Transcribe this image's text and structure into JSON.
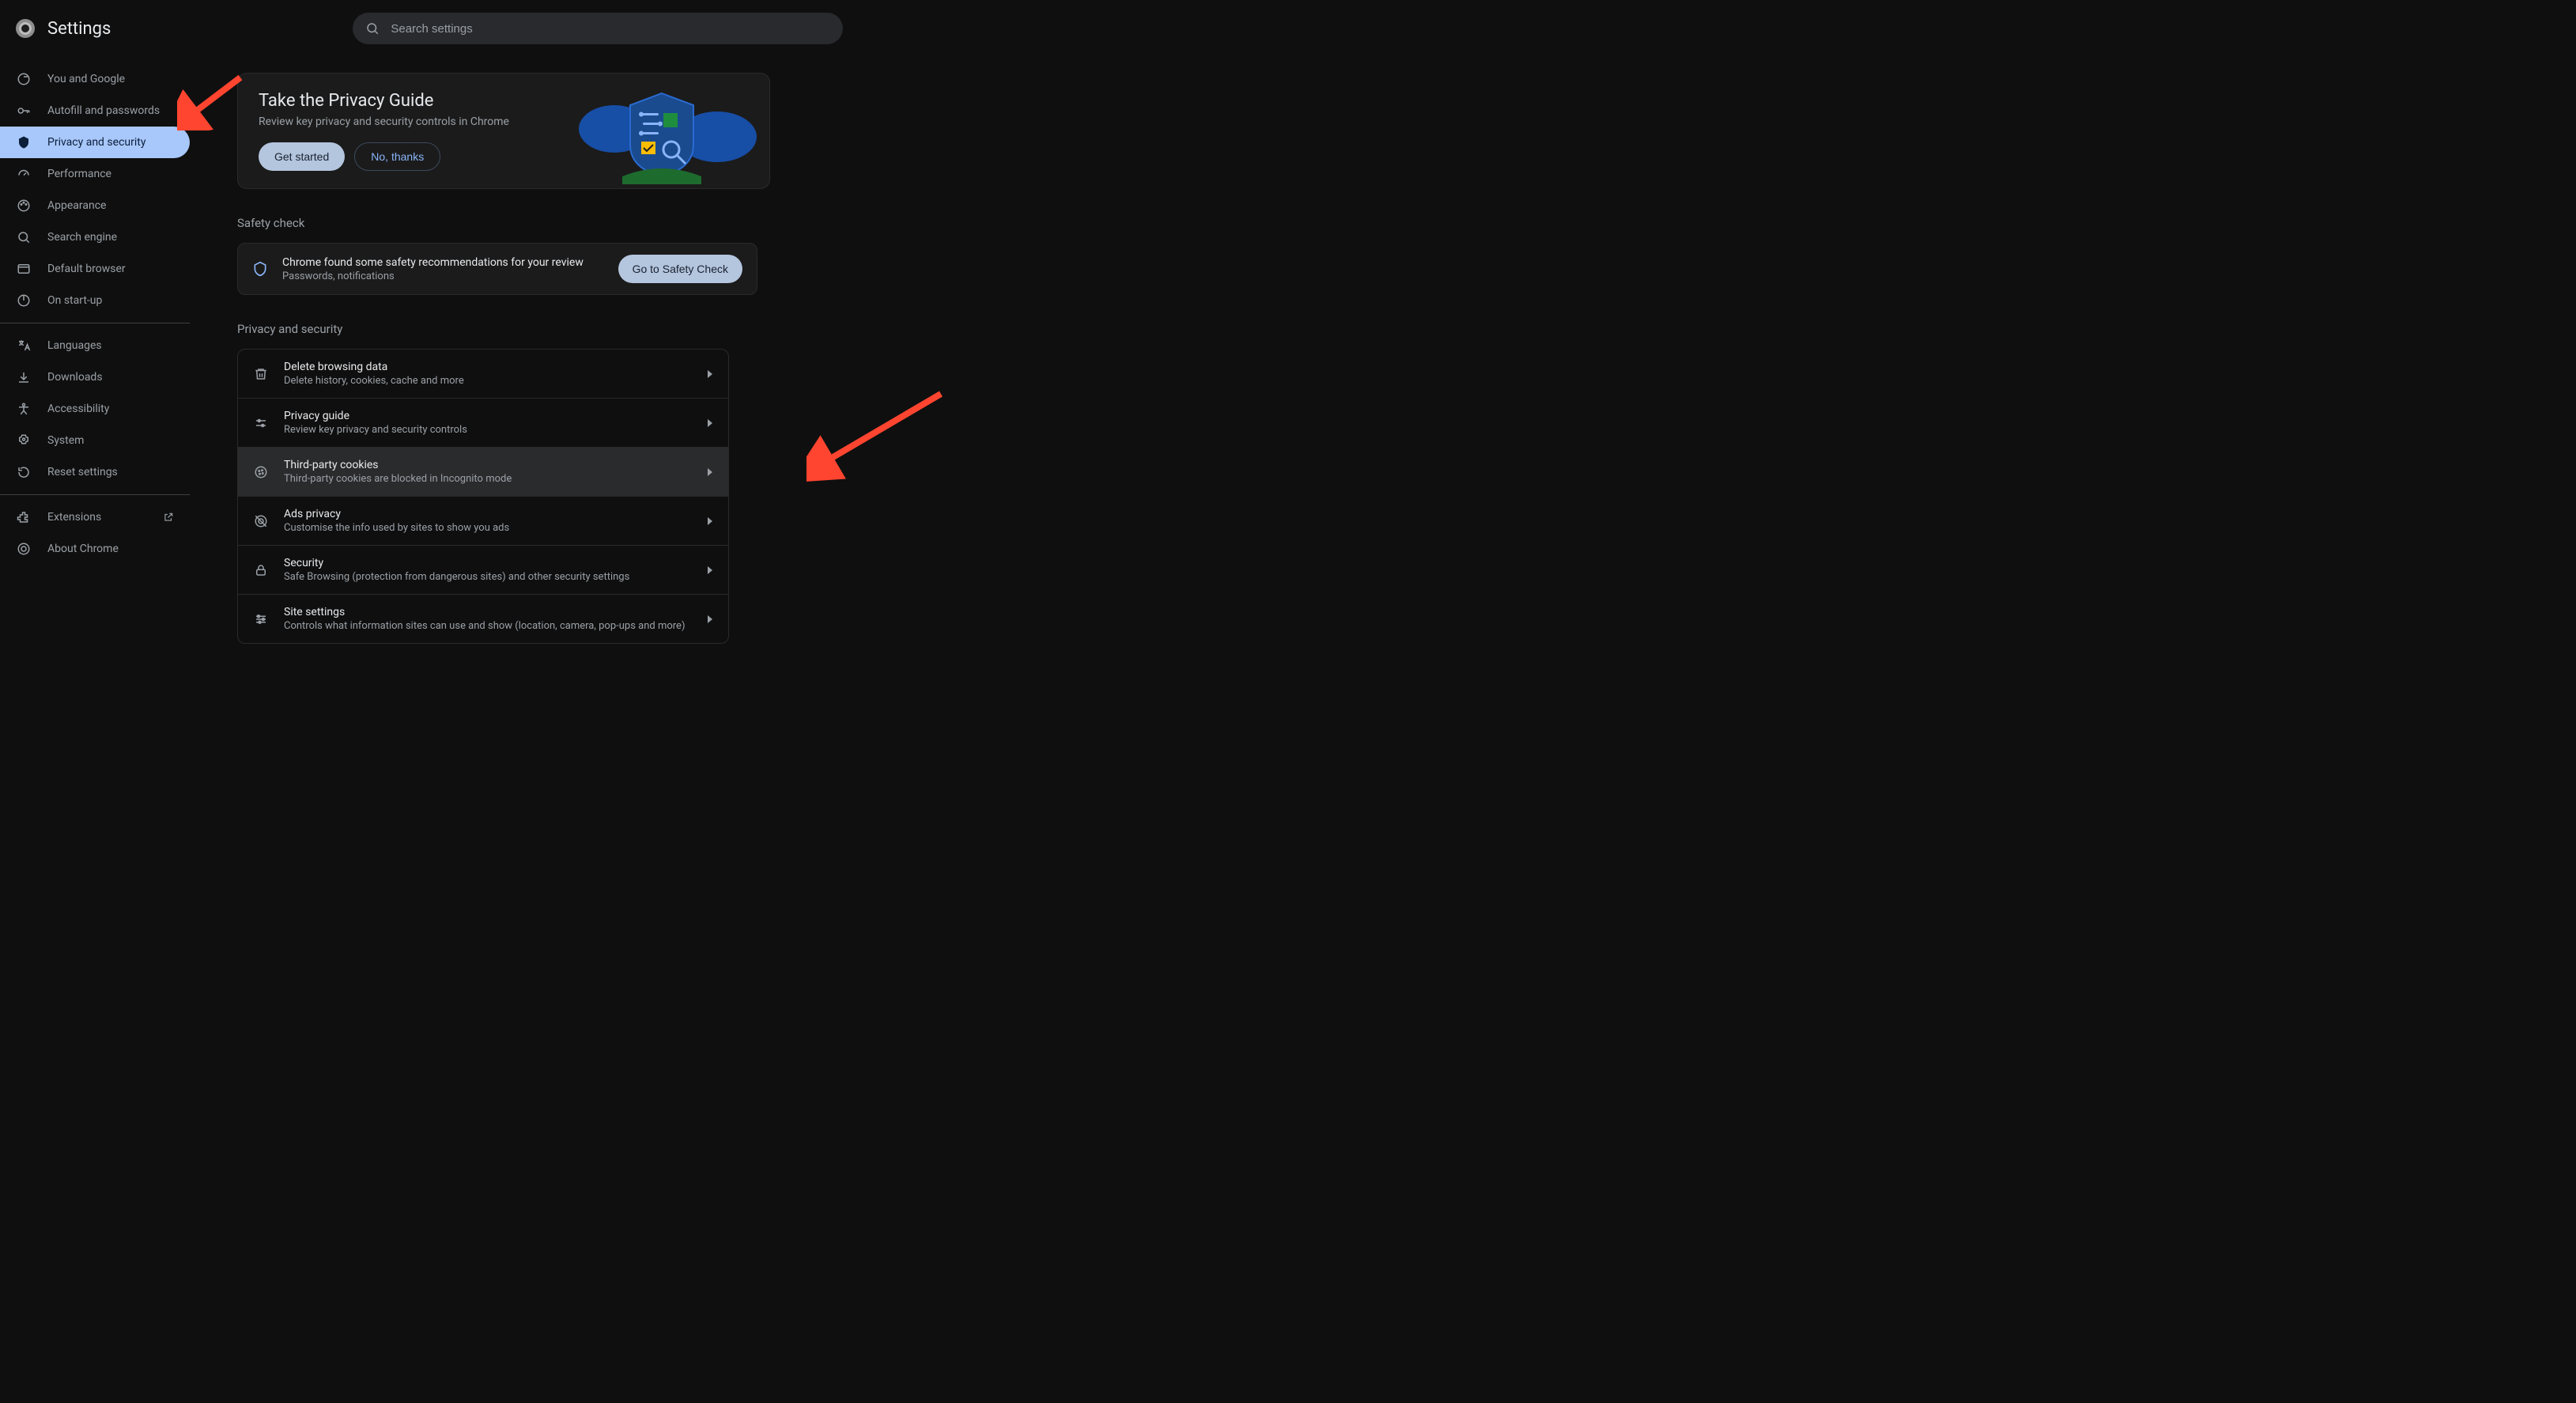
{
  "header": {
    "title": "Settings",
    "search_placeholder": "Search settings"
  },
  "sidebar": {
    "items": [
      {
        "label": "You and Google",
        "icon": "google"
      },
      {
        "label": "Autofill and passwords",
        "icon": "key"
      },
      {
        "label": "Privacy and security",
        "icon": "shield",
        "selected": true
      },
      {
        "label": "Performance",
        "icon": "speed"
      },
      {
        "label": "Appearance",
        "icon": "palette"
      },
      {
        "label": "Search engine",
        "icon": "search"
      },
      {
        "label": "Default browser",
        "icon": "browser"
      },
      {
        "label": "On start-up",
        "icon": "power"
      }
    ],
    "secondary": [
      {
        "label": "Languages",
        "icon": "translate"
      },
      {
        "label": "Downloads",
        "icon": "download"
      },
      {
        "label": "Accessibility",
        "icon": "accessibility"
      },
      {
        "label": "System",
        "icon": "system"
      },
      {
        "label": "Reset settings",
        "icon": "reset"
      }
    ],
    "footer": [
      {
        "label": "Extensions",
        "icon": "extension",
        "external": true
      },
      {
        "label": "About Chrome",
        "icon": "chrome"
      }
    ]
  },
  "guide_card": {
    "title": "Take the Privacy Guide",
    "subtitle": "Review key privacy and security controls in Chrome",
    "primary": "Get started",
    "secondary": "No, thanks"
  },
  "safety": {
    "heading": "Safety check",
    "line1": "Chrome found some safety recommendations for your review",
    "line2": "Passwords, notifications",
    "button": "Go to Safety Check"
  },
  "privacy": {
    "heading": "Privacy and security",
    "rows": [
      {
        "title": "Delete browsing data",
        "sub": "Delete history, cookies, cache and more",
        "icon": "trash"
      },
      {
        "title": "Privacy guide",
        "sub": "Review key privacy and security controls",
        "icon": "sliders"
      },
      {
        "title": "Third-party cookies",
        "sub": "Third-party cookies are blocked in Incognito mode",
        "icon": "cookie",
        "hover": true
      },
      {
        "title": "Ads privacy",
        "sub": "Customise the info used by sites to show you ads",
        "icon": "ads"
      },
      {
        "title": "Security",
        "sub": "Safe Browsing (protection from dangerous sites) and other security settings",
        "icon": "lock"
      },
      {
        "title": "Site settings",
        "sub": "Controls what information sites can use and show (location, camera, pop-ups and more)",
        "icon": "tune"
      }
    ]
  }
}
